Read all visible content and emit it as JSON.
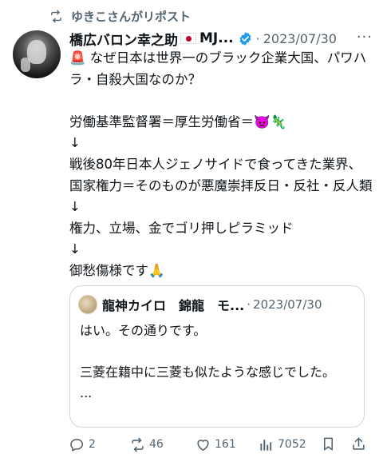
{
  "repost": {
    "text": "ゆきこさんがリポスト"
  },
  "post": {
    "display_name": "橋広バロン幸之助",
    "name_suffix": "MJ...",
    "date": "2023/07/30",
    "more": "···",
    "body": "🚨 なぜ日本は世界一のブラック企業大国、パワハラ・自殺大国なのか？\n\n労働基準監督署＝厚生労働省＝👿🦎\n↓\n戦後80年日本人ジェノサイドで食ってきた業界、国家権力＝そのものが悪魔崇拝反日・反社・反人類\n↓\n権力、立場、金でゴリ押しピラミッド\n↓\n御愁傷様です🙏"
  },
  "quote": {
    "name": "龍神カイロ　錦龍　モ...",
    "date": "2023/07/30",
    "text": "はい。その通りです。\n\n三菱在籍中に三菱も似たような感じでした。\n..."
  },
  "actions": {
    "replies": "2",
    "reposts": "46",
    "likes": "161",
    "views": "7052"
  },
  "colors": {
    "text": "#0f1419",
    "secondary": "#536471",
    "verified": "#1d9bf0",
    "border": "#cfd9de"
  },
  "icons": [
    "repost-icon",
    "verified-badge-icon",
    "reply-icon",
    "repost-icon",
    "like-icon",
    "views-icon",
    "bookmark-icon",
    "share-icon"
  ]
}
